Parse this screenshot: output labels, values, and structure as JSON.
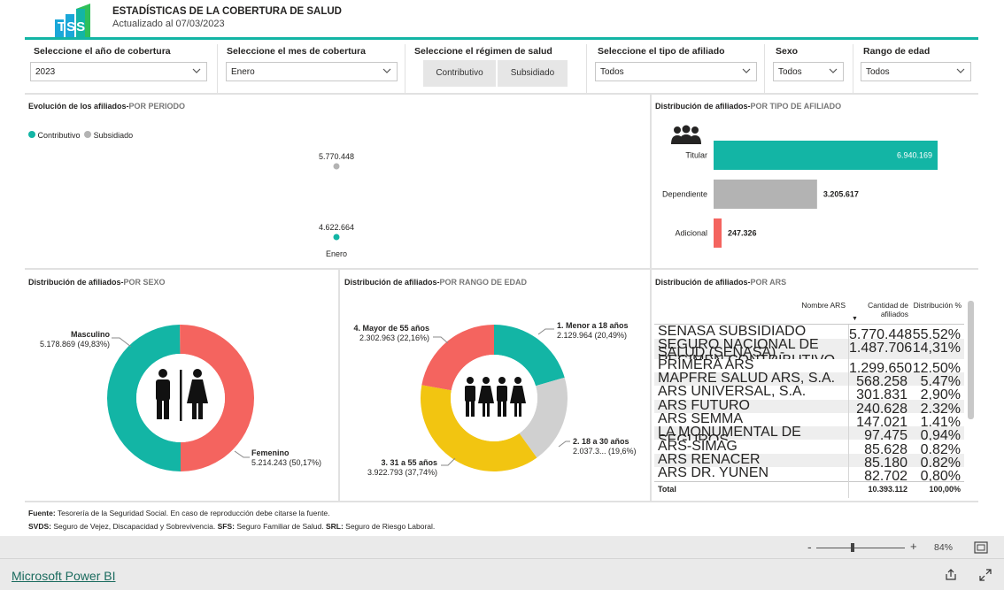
{
  "header": {
    "title": "ESTADÍSTICAS DE LA COBERTURA DE SALUD",
    "updated": "Actualizado al 07/03/2023",
    "logo_text": "TSS"
  },
  "slicers": {
    "year": {
      "label": "Seleccione el año de cobertura",
      "value": "2023"
    },
    "month": {
      "label": "Seleccione el mes de cobertura",
      "value": "Enero"
    },
    "regime": {
      "label": "Seleccione el régimen de salud",
      "options": [
        "Contributivo",
        "Subsidiado"
      ]
    },
    "affiliate_type": {
      "label": "Seleccione el tipo de afiliado",
      "value": "Todos"
    },
    "sex": {
      "label": "Sexo",
      "value": "Todos"
    },
    "age_range": {
      "label": "Rango de edad",
      "value": "Todos"
    }
  },
  "period_panel": {
    "title": "Evolución de los afiliados-",
    "title_accent": "POR PERIODO",
    "legend": [
      {
        "name": "Contributivo",
        "color": "#13b5a5"
      },
      {
        "name": "Subsidiado",
        "color": "#b3b3b3"
      }
    ],
    "chart_data": {
      "type": "scatter",
      "x": [
        "Enero"
      ],
      "series": [
        {
          "name": "Subsidiado",
          "values": [
            5770448
          ],
          "label": "5.770.448",
          "color": "#b3b3b3"
        },
        {
          "name": "Contributivo",
          "values": [
            4622664
          ],
          "label": "4.622.664",
          "color": "#13b5a5"
        }
      ],
      "tick_label": "Enero"
    }
  },
  "type_panel": {
    "title": "Distribución de afiliados-",
    "title_accent": "POR TIPO DE AFILIADO",
    "icon": "people-icon",
    "chart_data": {
      "type": "bar",
      "categories": [
        "Titular",
        "Dependiente",
        "Adicional"
      ],
      "values": [
        6940169,
        3205617,
        247326
      ],
      "labels": [
        "6.940.169",
        "3.205.617",
        "247.326"
      ],
      "colors": [
        "#13b5a5",
        "#b3b3b3",
        "#f4645f"
      ]
    }
  },
  "sex_panel": {
    "title": "Distribución de afiliados-",
    "title_accent": "POR SEXO",
    "icon": "man-woman-icon",
    "chart_data": {
      "type": "pie",
      "categories": [
        "Masculino",
        "Femenino"
      ],
      "values": [
        5178869,
        5214243
      ],
      "value_labels": [
        "5.178.869 (49,83%)",
        "5.214.243 (50,17%)"
      ],
      "colors": [
        "#13b5a5",
        "#f4645f"
      ]
    }
  },
  "age_panel": {
    "title": "Distribución de afiliados-",
    "title_accent": "POR RANGO DE EDAD",
    "icon": "group-icon",
    "chart_data": {
      "type": "pie",
      "categories": [
        "1. Menor a 18 años",
        "2. 18 a 30 años",
        "3. 31 a 55 años",
        "4. Mayor de 55 años"
      ],
      "values": [
        2129964,
        2037300,
        3922793,
        2302963
      ],
      "value_labels": [
        "2.129.964 (20,49%)",
        "2.037.3... (19,6%)",
        "3.922.793 (37,74%)",
        "2.302.963 (22,16%)"
      ],
      "colors": [
        "#13b5a5",
        "#d0d0d0",
        "#f2c511",
        "#f4645f"
      ]
    }
  },
  "ars_panel": {
    "title": "Distribución de afiliados-",
    "title_accent": "POR ARS",
    "columns": [
      "Nombre ARS",
      "Cantidad de afiliados",
      "Distribución %"
    ],
    "rows": [
      {
        "name": "SENASA SUBSIDIADO",
        "count": "5.770.448",
        "pct": "55,52%"
      },
      {
        "name": "SEGURO NACIONAL DE SALUD (SENASA) - REGIMEN CONTRIBUTIVO",
        "count": "1.487.706",
        "pct": "14,31%"
      },
      {
        "name": "PRIMERA ARS",
        "count": "1.299.650",
        "pct": "12,50%"
      },
      {
        "name": "MAPFRE SALUD ARS, S.A.",
        "count": "568.258",
        "pct": "5,47%"
      },
      {
        "name": "ARS UNIVERSAL, S.A.",
        "count": "301.831",
        "pct": "2,90%"
      },
      {
        "name": "ARS FUTURO",
        "count": "240.628",
        "pct": "2,32%"
      },
      {
        "name": "ARS SEMMA",
        "count": "147.021",
        "pct": "1,41%"
      },
      {
        "name": "LA MONUMENTAL DE SEGUROS",
        "count": "97.475",
        "pct": "0,94%"
      },
      {
        "name": "ARS-SIMAG",
        "count": "85.628",
        "pct": "0,82%"
      },
      {
        "name": "ARS RENACER",
        "count": "85.180",
        "pct": "0,82%"
      },
      {
        "name": "ARS DR. YUNEN",
        "count": "82.702",
        "pct": "0,80%"
      }
    ],
    "total": {
      "label": "Total",
      "count": "10.393.112",
      "pct": "100,00%"
    }
  },
  "footer": {
    "fuente_label": "Fuente:",
    "fuente_text": " Tesorería de la Seguridad Social. En caso de reproducción debe citarse la fuente.",
    "svds_label": "SVDS:",
    "svds_text": " Seguro de Vejez, Discapacidad y Sobrevivencia. ",
    "sfs_label": "SFS:",
    "sfs_text": " Seguro Familiar de Salud. ",
    "srl_label": "SRL:",
    "srl_text": " Seguro de Riesgo Laboral."
  },
  "zoom": {
    "minus": "-",
    "plus": "+",
    "level": "84%"
  },
  "bottom": {
    "brand": "Microsoft Power BI"
  },
  "colors": {
    "teal": "#13b5a5",
    "gray": "#b3b3b3",
    "red": "#f4645f",
    "yellow": "#f2c511"
  }
}
